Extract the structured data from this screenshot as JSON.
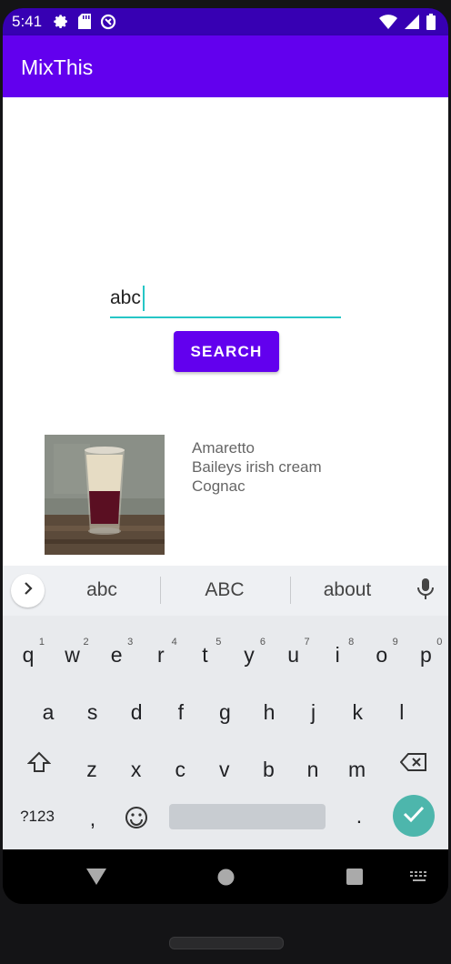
{
  "status": {
    "time": "5:41"
  },
  "app": {
    "title": "MixThis"
  },
  "search": {
    "value": "abc",
    "button_label": "SEARCH",
    "accent": "#26c6c6"
  },
  "results": [
    {
      "ingredients": [
        "Amaretto",
        "Baileys irish cream",
        "Cognac"
      ]
    }
  ],
  "keyboard": {
    "suggestions": [
      "abc",
      "ABC",
      "about"
    ],
    "row1": [
      {
        "k": "q",
        "n": "1"
      },
      {
        "k": "w",
        "n": "2"
      },
      {
        "k": "e",
        "n": "3"
      },
      {
        "k": "r",
        "n": "4"
      },
      {
        "k": "t",
        "n": "5"
      },
      {
        "k": "y",
        "n": "6"
      },
      {
        "k": "u",
        "n": "7"
      },
      {
        "k": "i",
        "n": "8"
      },
      {
        "k": "o",
        "n": "9"
      },
      {
        "k": "p",
        "n": "0"
      }
    ],
    "row2": [
      "a",
      "s",
      "d",
      "f",
      "g",
      "h",
      "j",
      "k",
      "l"
    ],
    "row3": [
      "z",
      "x",
      "c",
      "v",
      "b",
      "n",
      "m"
    ],
    "symbols_label": "?123",
    "comma": ",",
    "period": "."
  },
  "colors": {
    "primary": "#6200ee",
    "primary_dark": "#3700b3",
    "enter": "#4db6ac"
  }
}
